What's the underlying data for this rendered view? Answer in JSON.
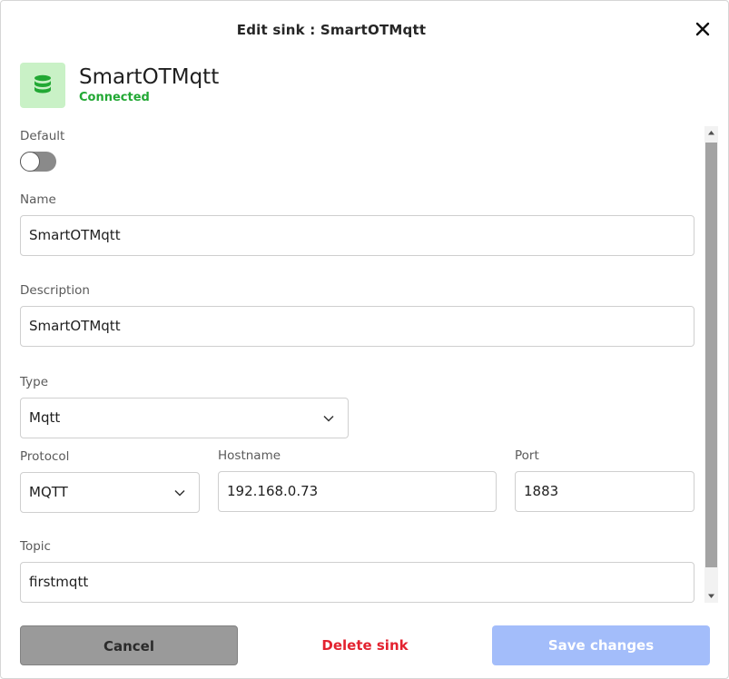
{
  "dialog": {
    "title": "Edit sink : SmartOTMqtt"
  },
  "sink": {
    "name": "SmartOTMqtt",
    "status": "Connected",
    "icon": "database-icon",
    "icon_color": "#22a834",
    "status_color": "#22a834"
  },
  "form": {
    "default_label": "Default",
    "default_value": false,
    "name_label": "Name",
    "name_value": "SmartOTMqtt",
    "description_label": "Description",
    "description_value": "SmartOTMqtt",
    "type_label": "Type",
    "type_value": "Mqtt",
    "protocol_label": "Protocol",
    "protocol_value": "MQTT",
    "hostname_label": "Hostname",
    "hostname_value": "192.168.0.73",
    "port_label": "Port",
    "port_value": "1883",
    "topic_label": "Topic",
    "topic_value": "firstmqtt"
  },
  "actions": {
    "cancel_label": "Cancel",
    "delete_label": "Delete sink",
    "save_label": "Save changes",
    "delete_color": "#e3222f",
    "save_color": "#a3bdfa"
  }
}
